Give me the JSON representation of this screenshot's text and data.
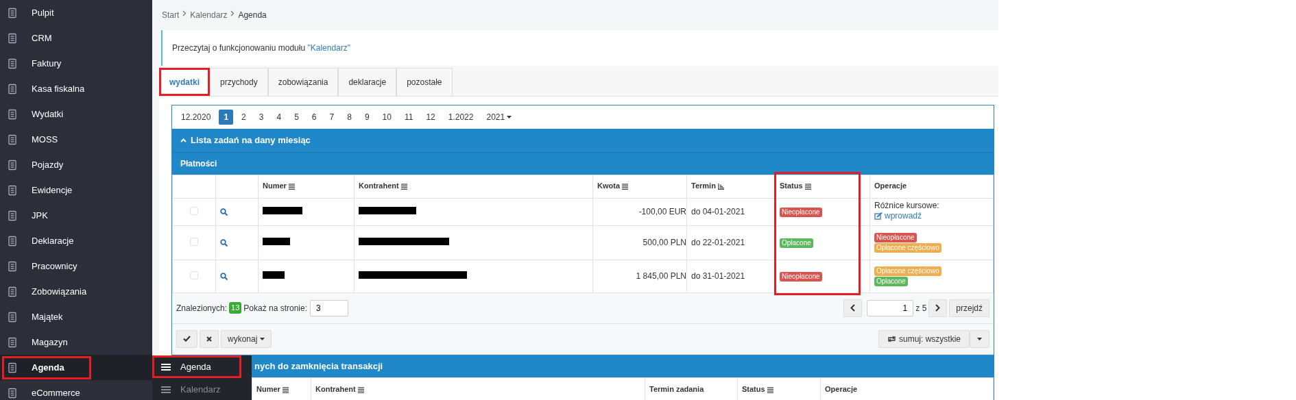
{
  "sidebar": {
    "items": [
      {
        "label": "Pulpit",
        "selected": false,
        "highlighted": false
      },
      {
        "label": "CRM",
        "selected": false,
        "highlighted": false
      },
      {
        "label": "Faktury",
        "selected": false,
        "highlighted": false
      },
      {
        "label": "Kasa fiskalna",
        "selected": false,
        "highlighted": false
      },
      {
        "label": "Wydatki",
        "selected": false,
        "highlighted": false
      },
      {
        "label": "MOSS",
        "selected": false,
        "highlighted": false
      },
      {
        "label": "Pojazdy",
        "selected": false,
        "highlighted": false
      },
      {
        "label": "Ewidencje",
        "selected": false,
        "highlighted": false
      },
      {
        "label": "JPK",
        "selected": false,
        "highlighted": false
      },
      {
        "label": "Deklaracje",
        "selected": false,
        "highlighted": false
      },
      {
        "label": "Pracownicy",
        "selected": false,
        "highlighted": false
      },
      {
        "label": "Zobowiązania",
        "selected": false,
        "highlighted": false
      },
      {
        "label": "Majątek",
        "selected": false,
        "highlighted": false
      },
      {
        "label": "Magazyn",
        "selected": false,
        "highlighted": false
      },
      {
        "label": "Agenda",
        "selected": true,
        "highlighted": true
      },
      {
        "label": "eCommerce",
        "selected": false,
        "highlighted": false
      }
    ]
  },
  "submenu": {
    "items": [
      {
        "label": "Agenda",
        "selected": true,
        "highlighted": true
      },
      {
        "label": "Kalendarz",
        "selected": false,
        "highlighted": false
      }
    ]
  },
  "breadcrumb": [
    "Start",
    "Kalendarz",
    "Agenda"
  ],
  "info": {
    "text": "Przeczytaj o funkcjonowaniu modułu",
    "link": "\"Kalendarz\""
  },
  "tabs": [
    {
      "label": "wydatki",
      "selected": true,
      "highlighted": true
    },
    {
      "label": "przychody",
      "selected": false,
      "highlighted": false
    },
    {
      "label": "zobowiązania",
      "selected": false,
      "highlighted": false
    },
    {
      "label": "deklaracje",
      "selected": false,
      "highlighted": false
    },
    {
      "label": "pozostałe",
      "selected": false,
      "highlighted": false
    }
  ],
  "month_pager": {
    "items": [
      {
        "label": "12.2020",
        "selected": false
      },
      {
        "label": "1",
        "selected": true
      },
      {
        "label": "2",
        "selected": false
      },
      {
        "label": "3",
        "selected": false
      },
      {
        "label": "4",
        "selected": false
      },
      {
        "label": "5",
        "selected": false
      },
      {
        "label": "6",
        "selected": false
      },
      {
        "label": "7",
        "selected": false
      },
      {
        "label": "8",
        "selected": false
      },
      {
        "label": "9",
        "selected": false
      },
      {
        "label": "10",
        "selected": false
      },
      {
        "label": "11",
        "selected": false
      },
      {
        "label": "12",
        "selected": false
      },
      {
        "label": "1.2022",
        "selected": false
      }
    ],
    "year": "2021"
  },
  "panel": {
    "title": "Lista zadań na dany miesiąc",
    "expanded": true
  },
  "payments": {
    "title": "Płatności",
    "columns": [
      {
        "label": "Numer",
        "sortable": true,
        "sorted": false
      },
      {
        "label": "Kontrahent",
        "sortable": true,
        "sorted": false
      },
      {
        "label": "Kwota",
        "sortable": true,
        "sorted": false
      },
      {
        "label": "Termin",
        "sortable": true,
        "sorted": true
      },
      {
        "label": "Status",
        "sortable": true,
        "sorted": false,
        "highlighted": true
      },
      {
        "label": "Operacje",
        "sortable": false,
        "sorted": false
      }
    ],
    "rows": [
      {
        "checked": false,
        "numer_redacted": true,
        "kontrahent_redacted": true,
        "kwota": "-100,00 EUR",
        "termin": "do 04-01-2021",
        "status": {
          "text": "Nieopłacone",
          "kind": "danger"
        },
        "operations": {
          "kind": "link",
          "label": "Różnice kursowe:",
          "link": "wprowadź"
        }
      },
      {
        "checked": false,
        "numer_redacted": true,
        "kontrahent_redacted": true,
        "kwota": "500,00 PLN",
        "termin": "do 22-01-2021",
        "status": {
          "text": "Opłacone",
          "kind": "success"
        },
        "operations": {
          "kind": "badges",
          "badges": [
            {
              "text": "Nieopłacone",
              "kind": "danger"
            },
            {
              "text": "Opłacone częściowo",
              "kind": "warning"
            }
          ]
        }
      },
      {
        "checked": false,
        "numer_redacted": true,
        "kontrahent_redacted": true,
        "kwota": "1 845,00 PLN",
        "termin": "do 31-01-2021",
        "status": {
          "text": "Nieopłacone",
          "kind": "danger"
        },
        "operations": {
          "kind": "badges",
          "badges": [
            {
              "text": "Opłacone częściowo",
              "kind": "warning"
            },
            {
              "text": "Opłacone",
              "kind": "success"
            }
          ]
        }
      }
    ]
  },
  "footer": {
    "found_label": "Znalezionych:",
    "found_count": "13",
    "per_page_label": "Pokaż na stronie:",
    "per_page": "3",
    "page": "1",
    "of": "z 5",
    "go": "przejdź"
  },
  "actions": {
    "execute": "wykonaj",
    "sum": "sumuj: wszystkie"
  },
  "closing": {
    "title": "nych do zamknięcia transakcji",
    "columns": [
      {
        "label": "Numer",
        "sortable": true,
        "sorted": false
      },
      {
        "label": "Kontrahent",
        "sortable": true,
        "sorted": false
      },
      {
        "label": "Termin zadania",
        "sortable": false,
        "sorted": false
      },
      {
        "label": "Status",
        "sortable": true,
        "sorted": false
      },
      {
        "label": "Operacje",
        "sortable": false,
        "sorted": false
      }
    ]
  }
}
